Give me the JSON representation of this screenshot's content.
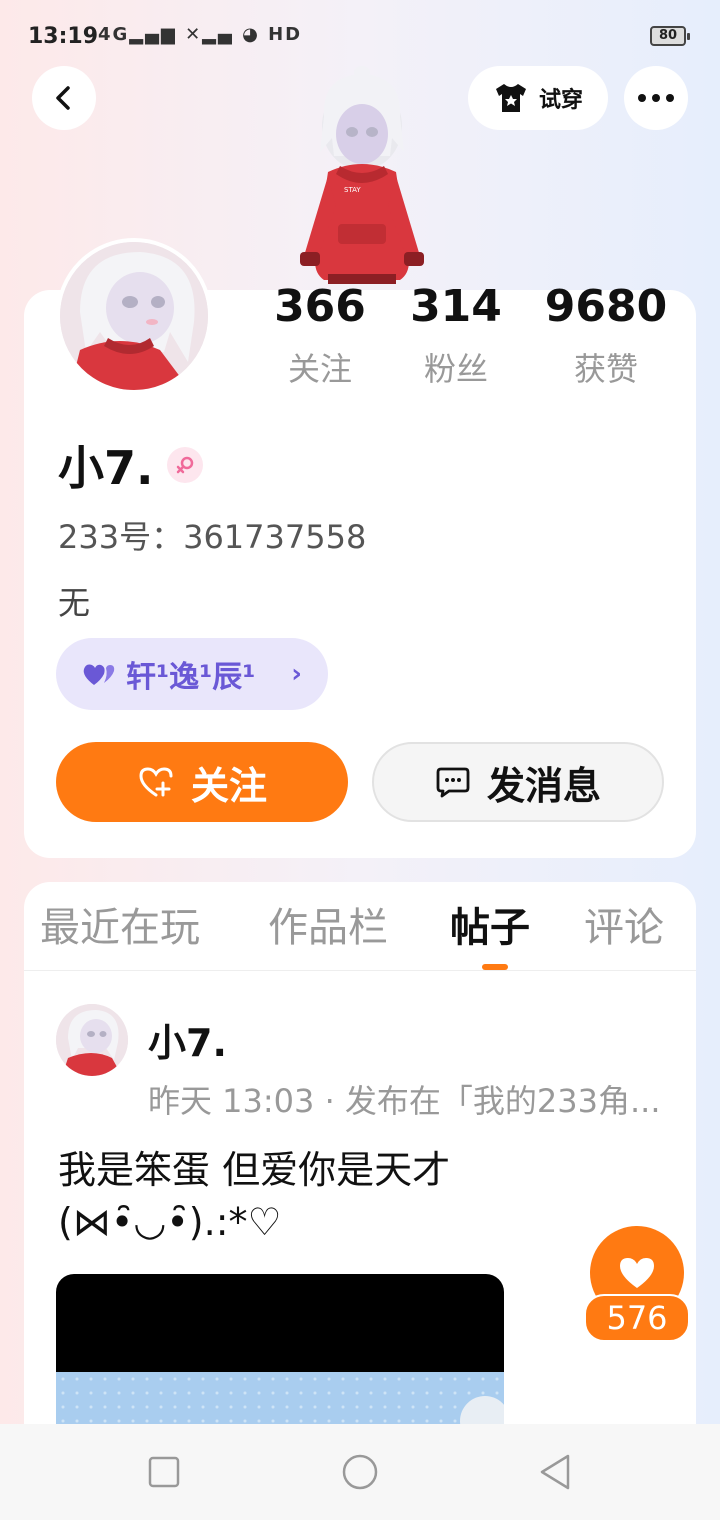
{
  "status_bar": {
    "time": "13:19",
    "signal": "4G▂▄▆ ✕▂▄ ◕ HD",
    "battery": "80"
  },
  "header": {
    "try_on_label": "试穿"
  },
  "profile": {
    "stats": [
      {
        "value": "366",
        "label": "关注"
      },
      {
        "value": "314",
        "label": "粉丝"
      },
      {
        "value": "9680",
        "label": "获赞"
      }
    ],
    "username": "小7.",
    "user_id": "233号：361737558",
    "bio": "无",
    "fan_group_label": "轩¹逸¹辰¹",
    "follow_label": "关注",
    "message_label": "发消息"
  },
  "tabs": [
    {
      "label": "最近在玩",
      "active": false
    },
    {
      "label": "作品栏",
      "active": false
    },
    {
      "label": "帖子",
      "active": true
    },
    {
      "label": "评论",
      "active": false
    }
  ],
  "post": {
    "author": "小7.",
    "meta": "昨天 13:03 · 发布在「我的233角...",
    "text": "我是笨蛋 但爱你是天才(⋈•̑◡•̑).:*♡",
    "like_count": "576"
  },
  "colors": {
    "accent": "#ff7a12",
    "fan_chip_bg": "#e9e6fb",
    "fan_chip_text": "#6a58d6"
  }
}
